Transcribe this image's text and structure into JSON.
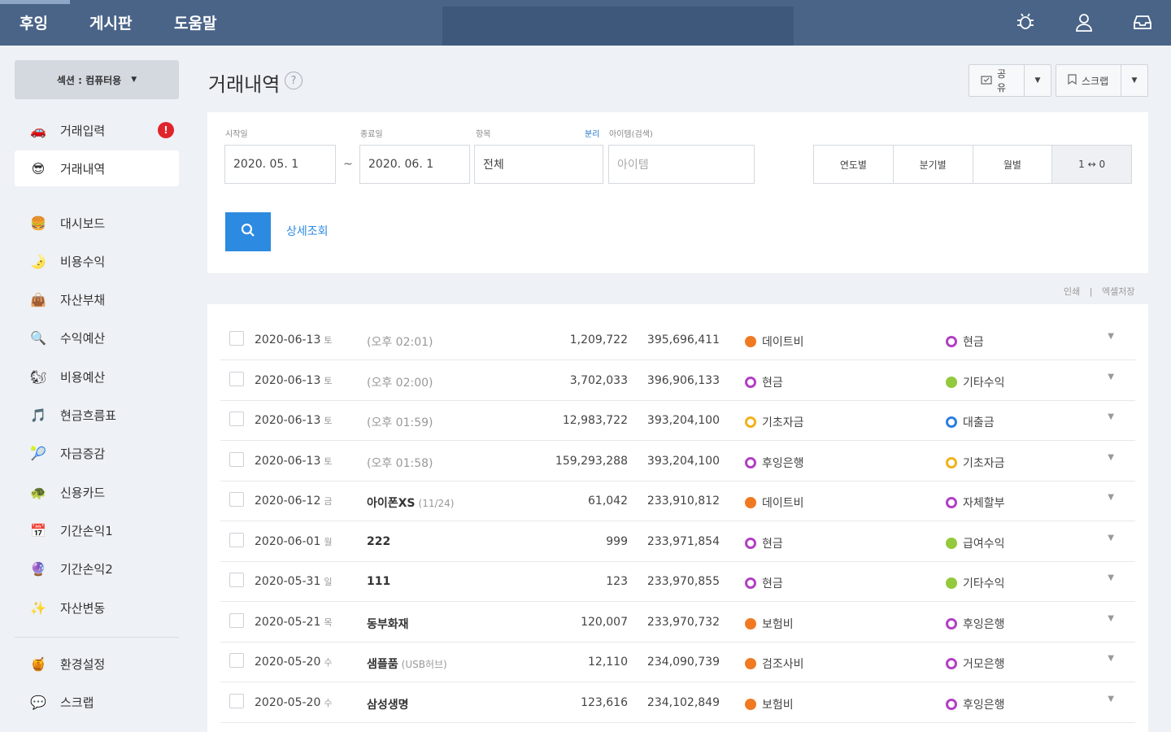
{
  "topnav": {
    "items": [
      "후잉",
      "게시판",
      "도움말"
    ],
    "icons": [
      "bug-icon",
      "user-icon",
      "inbox-icon"
    ]
  },
  "sidebar": {
    "section_label": "섹션 : 컴퓨터용",
    "main_items": [
      {
        "label": "거래입력",
        "icon": "car-icon",
        "glyph": "🚗",
        "badge": "!"
      },
      {
        "label": "거래내역",
        "icon": "smiley-icon",
        "glyph": "😎",
        "active": true
      }
    ],
    "items": [
      {
        "label": "대시보드",
        "icon": "burger-icon",
        "glyph": "🍔"
      },
      {
        "label": "비용수익",
        "icon": "moon-icon",
        "glyph": "🌛"
      },
      {
        "label": "자산부채",
        "icon": "safe-icon",
        "glyph": "👜"
      },
      {
        "label": "수익예산",
        "icon": "magnifier-icon",
        "glyph": "🔍"
      },
      {
        "label": "비용예산",
        "icon": "squirrel-icon",
        "glyph": "🐿"
      },
      {
        "label": "현금흐름표",
        "icon": "music-icon",
        "glyph": "🎵"
      },
      {
        "label": "자금증감",
        "icon": "ball-icon",
        "glyph": "🎾"
      },
      {
        "label": "신용카드",
        "icon": "turtle-icon",
        "glyph": "🐢"
      },
      {
        "label": "기간손익1",
        "icon": "calendar-icon",
        "glyph": "📅"
      },
      {
        "label": "기간손익2",
        "icon": "crystal-ball-icon",
        "glyph": "🔮"
      },
      {
        "label": "자산변동",
        "icon": "sparkle-icon",
        "glyph": "✨"
      }
    ],
    "bottom_items": [
      {
        "label": "환경설정",
        "icon": "honey-icon",
        "glyph": "🍯"
      },
      {
        "label": "스크랩",
        "icon": "speech-icon",
        "glyph": "💬"
      }
    ]
  },
  "header": {
    "title": "거래내역",
    "share_label": "공유",
    "scrap_label": "스크랩"
  },
  "filter": {
    "start_label": "시작일",
    "start_value": "2020. 05. 1",
    "end_label": "종료일",
    "end_value": "2020. 06. 1",
    "item_label": "항목",
    "item_value": "전체",
    "toggle_label": "분리",
    "itemname_label": "아이템(검색)",
    "itemname_placeholder": "아이템",
    "periods": [
      "연도별",
      "분기별",
      "월별",
      "1 ↔ 0"
    ],
    "detail_link": "상세조회"
  },
  "list_tools": {
    "print": "인쇄",
    "excel": "엑셀저장"
  },
  "colors": {
    "orange": "#f07a22",
    "purple": "#b23fc4",
    "green": "#93c93c",
    "yellow": "#f2b21b",
    "blue": "#2c7ee3"
  },
  "transactions": [
    {
      "date": "2020-06-13",
      "day": "토",
      "desc": "(오후 02:01)",
      "is_time": true,
      "amount": "1,209,722",
      "balance": "395,696,411",
      "cat": "데이트비",
      "cat_color": "#f07a22",
      "cat_ring": false,
      "acc": "현금",
      "acc_color": "#b23fc4",
      "acc_ring": true
    },
    {
      "date": "2020-06-13",
      "day": "토",
      "desc": "(오후 02:00)",
      "is_time": true,
      "amount": "3,702,033",
      "balance": "396,906,133",
      "cat": "현금",
      "cat_color": "#b23fc4",
      "cat_ring": true,
      "acc": "기타수익",
      "acc_color": "#93c93c",
      "acc_ring": false
    },
    {
      "date": "2020-06-13",
      "day": "토",
      "desc": "(오후 01:59)",
      "is_time": true,
      "amount": "12,983,722",
      "balance": "393,204,100",
      "cat": "기초자금",
      "cat_color": "#f2b21b",
      "cat_ring": true,
      "acc": "대출금",
      "acc_color": "#2c7ee3",
      "acc_ring": true
    },
    {
      "date": "2020-06-13",
      "day": "토",
      "desc": "(오후 01:58)",
      "is_time": true,
      "amount": "159,293,288",
      "balance": "393,204,100",
      "cat": "후잉은행",
      "cat_color": "#b23fc4",
      "cat_ring": true,
      "acc": "기초자금",
      "acc_color": "#f2b21b",
      "acc_ring": true
    },
    {
      "date": "2020-06-12",
      "day": "금",
      "desc": "아이폰XS",
      "desc_note": "(11/24)",
      "amount": "61,042",
      "balance": "233,910,812",
      "cat": "데이트비",
      "cat_color": "#f07a22",
      "cat_ring": false,
      "acc": "자체할부",
      "acc_color": "#b23fc4",
      "acc_ring": true
    },
    {
      "date": "2020-06-01",
      "day": "월",
      "desc": "222",
      "amount": "999",
      "balance": "233,971,854",
      "cat": "현금",
      "cat_color": "#b23fc4",
      "cat_ring": true,
      "acc": "급여수익",
      "acc_color": "#93c93c",
      "acc_ring": false
    },
    {
      "date": "2020-05-31",
      "day": "일",
      "desc": "111",
      "amount": "123",
      "balance": "233,970,855",
      "cat": "현금",
      "cat_color": "#b23fc4",
      "cat_ring": true,
      "acc": "기타수익",
      "acc_color": "#93c93c",
      "acc_ring": false
    },
    {
      "date": "2020-05-21",
      "day": "목",
      "desc": "동부화재",
      "amount": "120,007",
      "balance": "233,970,732",
      "cat": "보험비",
      "cat_color": "#f07a22",
      "cat_ring": false,
      "acc": "후잉은행",
      "acc_color": "#b23fc4",
      "acc_ring": true
    },
    {
      "date": "2020-05-20",
      "day": "수",
      "desc": "샘플품",
      "desc_note": "(USB허브)",
      "amount": "12,110",
      "balance": "234,090,739",
      "cat": "검조사비",
      "cat_color": "#f07a22",
      "cat_ring": false,
      "acc": "거모은행",
      "acc_color": "#b23fc4",
      "acc_ring": true
    },
    {
      "date": "2020-05-20",
      "day": "수",
      "desc": "삼성생명",
      "amount": "123,616",
      "balance": "234,102,849",
      "cat": "보험비",
      "cat_color": "#f07a22",
      "cat_ring": false,
      "acc": "후잉은행",
      "acc_color": "#b23fc4",
      "acc_ring": true
    }
  ]
}
